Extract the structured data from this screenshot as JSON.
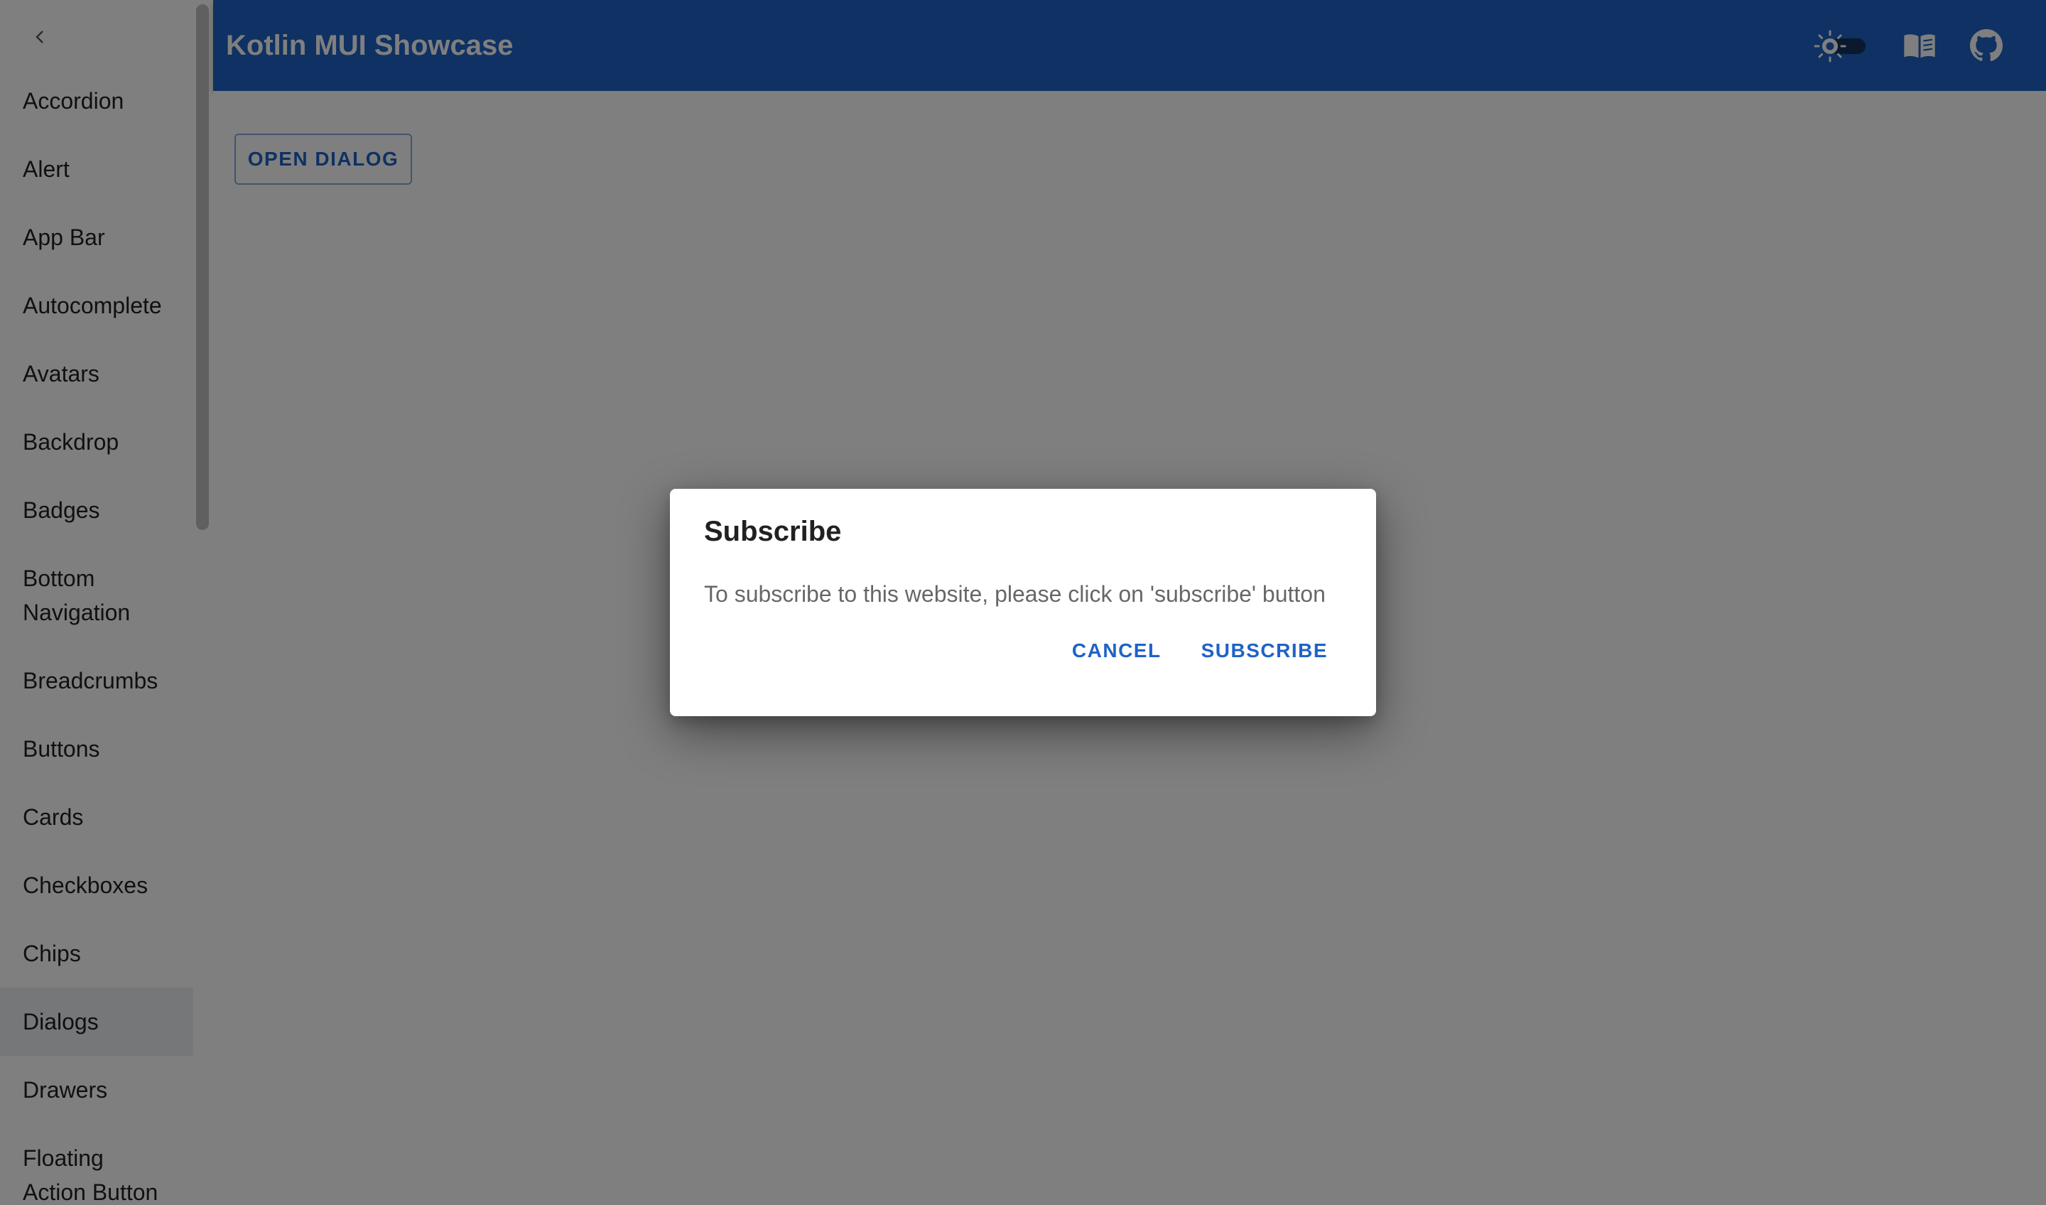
{
  "app": {
    "title": "Kotlin MUI Showcase"
  },
  "colors": {
    "primary": "#1e63c6",
    "selected_item_bg": "#ebeef3"
  },
  "sidebar": {
    "collapse_icon": "chevron-left-icon",
    "items": [
      {
        "label": "Accordion"
      },
      {
        "label": "Alert"
      },
      {
        "label": "App Bar"
      },
      {
        "label": "Autocomplete"
      },
      {
        "label": "Avatars"
      },
      {
        "label": "Backdrop"
      },
      {
        "label": "Badges"
      },
      {
        "label": "Bottom Navigation"
      },
      {
        "label": "Breadcrumbs"
      },
      {
        "label": "Buttons"
      },
      {
        "label": "Cards"
      },
      {
        "label": "Checkboxes"
      },
      {
        "label": "Chips"
      },
      {
        "label": "Dialogs",
        "selected": true
      },
      {
        "label": "Drawers"
      },
      {
        "label": "Floating Action Button"
      }
    ]
  },
  "toolbar": {
    "icons": [
      "theme-toggle-icon",
      "docs-book-icon",
      "github-icon"
    ]
  },
  "main": {
    "open_dialog_label": "OPEN DIALOG"
  },
  "dialog": {
    "title": "Subscribe",
    "text": "To subscribe to this website, please click on 'subscribe' button",
    "cancel_label": "CANCEL",
    "subscribe_label": "SUBSCRIBE"
  }
}
